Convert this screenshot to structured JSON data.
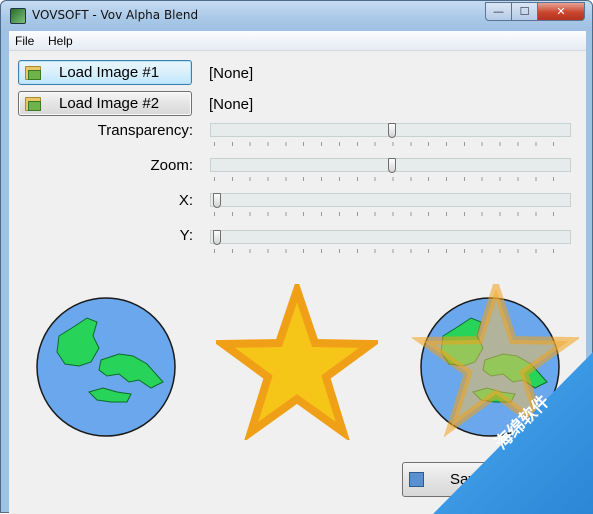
{
  "window": {
    "title": "VOVSOFT - Vov Alpha Blend",
    "min_glyph": "—",
    "max_glyph": "☐",
    "close_glyph": "✕"
  },
  "menu": {
    "file": "File",
    "help": "Help"
  },
  "loader": {
    "image1_button": "Load Image #1",
    "image1_path": "[None]",
    "image2_button": "Load Image #2",
    "image2_path": "[None]"
  },
  "params": {
    "transparency": {
      "label": "Transparency:",
      "value_fraction": 0.5
    },
    "zoom": {
      "label": "Zoom:",
      "value_fraction": 0.5
    },
    "x": {
      "label": "X:",
      "value_fraction": 0.0
    },
    "y": {
      "label": "Y:",
      "value_fraction": 0.0
    }
  },
  "previews": {
    "image1": "globe",
    "image2": "star",
    "blend": "globe + star"
  },
  "save": {
    "label": "Sav"
  },
  "watermark": {
    "text": "海绵软件"
  },
  "colors": {
    "ocean": "#6aa7ec",
    "land": "#28d35a",
    "star_fill": "#f5c518",
    "star_stroke": "#f0a017",
    "accent": "#3d9ae5"
  }
}
